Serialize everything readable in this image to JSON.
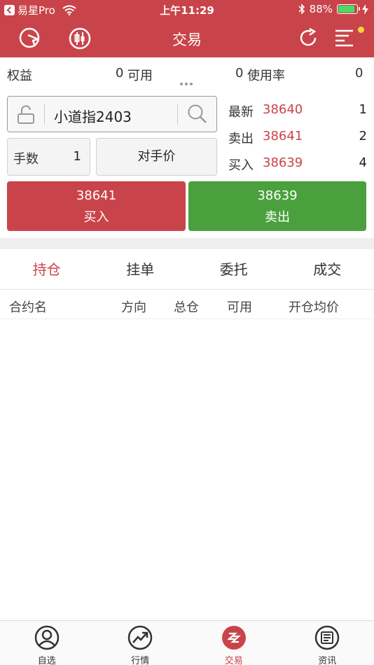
{
  "status_bar": {
    "back_app": "易星Pro",
    "time": "上午11:29",
    "battery": "88%",
    "battery_level": 0.88
  },
  "nav": {
    "title": "交易"
  },
  "account": {
    "equity_label": "权益",
    "equity_value": "0",
    "available_label": "可用",
    "available_value": "0",
    "usage_label": "使用率",
    "usage_value": "0"
  },
  "order": {
    "contract_name": "小道指2403",
    "qty_label": "手数",
    "qty_value": "1",
    "price_type": "对手价"
  },
  "quotes": [
    {
      "label": "最新",
      "price": "38640",
      "volume": "1"
    },
    {
      "label": "卖出",
      "price": "38641",
      "volume": "2"
    },
    {
      "label": "买入",
      "price": "38639",
      "volume": "4"
    }
  ],
  "buttons": {
    "buy_price": "38641",
    "buy_label": "买入",
    "sell_price": "38639",
    "sell_label": "卖出"
  },
  "tabs": [
    "持仓",
    "挂单",
    "委托",
    "成交"
  ],
  "table_headers": [
    "合约名",
    "方向",
    "总仓",
    "可用",
    "开仓均价"
  ],
  "bottom_tabs": [
    "自选",
    "行情",
    "交易",
    "资讯"
  ],
  "colors": {
    "brand_red": "#c9444a",
    "buy": "#c9444a",
    "sell": "#4aa03d"
  }
}
